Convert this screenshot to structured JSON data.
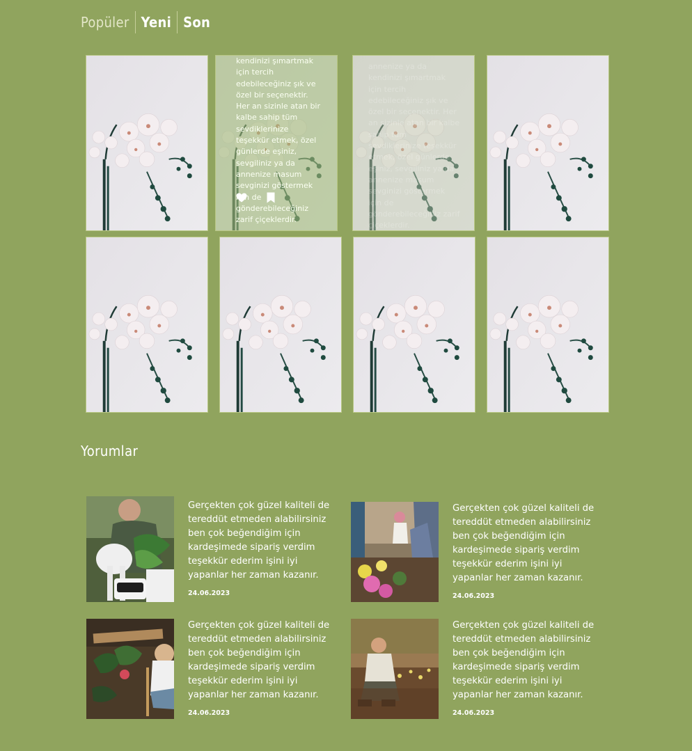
{
  "tabs": {
    "popular": "Popüler",
    "new": "Yeni",
    "last": "Son"
  },
  "gallery": {
    "overlay_text": "kendinizi şımartmak için tercih edebileceğiniz şık ve özel bir seçenektir. Her an sizinle atan bir kalbe sahip tüm sevdiklerinize teşekkür etmek, özel günlerde eşiniz, sevgiliniz ya da annenize masum sevginizi göstermek için de gönderebileceğiniz zarif çiçeklerdir.",
    "faint_text": "annenize ya da kendinizi şımartmak için tercih edebileceğiniz şık ve özel bir seçenektir. Her an sizinle atan bir kalbe sahip tüm sevdiklerinize teşekkür etmek, özel günlerde eşiniz, sevgiliniz ya da annenize masum sevginizi göstermek için de gönderebileceğiniz zarif çiçeklerdir."
  },
  "reviews": {
    "title": "Yorumlar",
    "items": [
      {
        "text": "Gerçekten çok güzel kaliteli de tereddüt etmeden alabilirsiniz ben çok beğendiğim için kardeşimede sipariş verdim teşekkür ederim işini iyi yapanlar her zaman kazanır.",
        "date": "24.06.2023"
      },
      {
        "text": "Gerçekten çok güzel kaliteli de tereddüt etmeden alabilirsiniz ben çok beğendiğim için kardeşimede sipariş verdim teşekkür ederim işini iyi yapanlar her zaman kazanır.",
        "date": "24.06.2023"
      },
      {
        "text": "Gerçekten çok güzel kaliteli de tereddüt etmeden alabilirsiniz ben çok beğendiğim için kardeşimede sipariş verdim teşekkür ederim işini iyi yapanlar her zaman kazanır.",
        "date": "24.06.2023"
      },
      {
        "text": "Gerçekten çok güzel kaliteli de tereddüt etmeden alabilirsiniz ben çok beğendiğim için kardeşimede sipariş verdim teşekkür ederim işini iyi yapanlar her zaman kazanır.",
        "date": "24.06.2023"
      }
    ]
  },
  "icons": {
    "like": "heart-icon",
    "save": "bookmark-icon"
  },
  "colors": {
    "background": "#90a45e",
    "overlay": "#a0b978",
    "tab_inactive": "#e4e7c9"
  }
}
